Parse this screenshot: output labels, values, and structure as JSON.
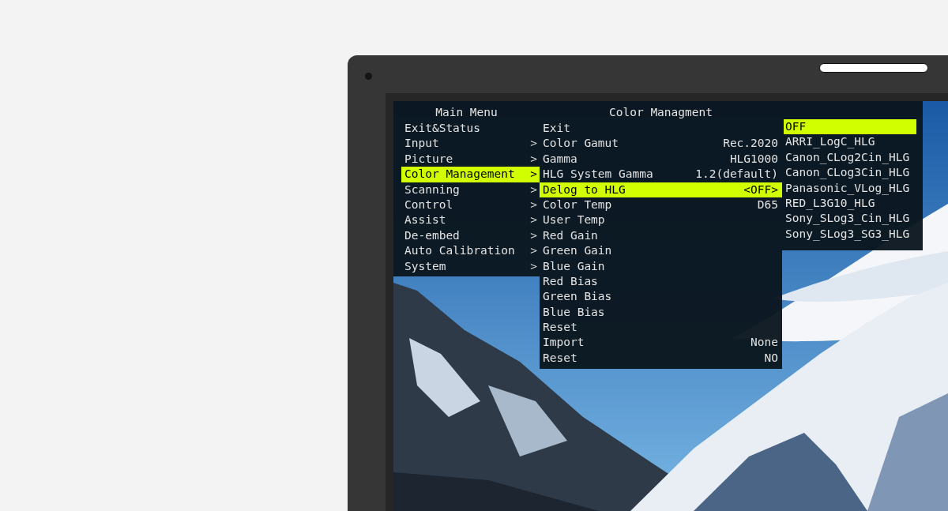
{
  "main_menu": {
    "title": "Main Menu",
    "items": [
      {
        "label": "Exit&Status",
        "selected": false
      },
      {
        "label": "Input",
        "arrow": ">",
        "selected": false
      },
      {
        "label": "Picture",
        "arrow": ">",
        "selected": false
      },
      {
        "label": "Color Management",
        "arrow": ">",
        "selected": true
      },
      {
        "label": "Scanning",
        "arrow": ">",
        "selected": false
      },
      {
        "label": "Control",
        "arrow": ">",
        "selected": false
      },
      {
        "label": "Assist",
        "arrow": ">",
        "selected": false
      },
      {
        "label": "De-embed",
        "arrow": ">",
        "selected": false
      },
      {
        "label": "Auto Calibration",
        "arrow": ">",
        "selected": false
      },
      {
        "label": "System",
        "arrow": ">",
        "selected": false
      }
    ]
  },
  "submenu": {
    "title": "Color Managment",
    "items": [
      {
        "label": "Exit",
        "selected": false
      },
      {
        "label": "Color Gamut",
        "value": "Rec.2020",
        "selected": false
      },
      {
        "label": "Gamma",
        "value": "HLG1000",
        "selected": false
      },
      {
        "label": "HLG System Gamma",
        "value": "1.2(default)",
        "selected": false
      },
      {
        "label": "Delog to HLG",
        "value": "<OFF>",
        "selected": true
      },
      {
        "label": "Color Temp",
        "value": "D65",
        "selected": false
      },
      {
        "label": "User Temp",
        "selected": false
      },
      {
        "label": "Red Gain",
        "selected": false
      },
      {
        "label": "Green Gain",
        "selected": false
      },
      {
        "label": "Blue Gain",
        "selected": false
      },
      {
        "label": "Red Bias",
        "selected": false
      },
      {
        "label": "Green Bias",
        "selected": false
      },
      {
        "label": "Blue Bias",
        "selected": false
      },
      {
        "label": "Reset",
        "selected": false
      },
      {
        "label": "Import",
        "value": "None",
        "selected": false
      },
      {
        "label": "Reset",
        "value": "NO",
        "selected": false
      }
    ]
  },
  "options": {
    "items": [
      {
        "label": "OFF",
        "selected": true
      },
      {
        "label": "ARRI_LogC_HLG",
        "selected": false
      },
      {
        "label": "Canon_CLog2Cin_HLG",
        "selected": false
      },
      {
        "label": "Canon_CLog3Cin_HLG",
        "selected": false
      },
      {
        "label": "Panasonic_VLog_HLG",
        "selected": false
      },
      {
        "label": "RED_L3G10_HLG",
        "selected": false
      },
      {
        "label": "Sony_SLog3_Cin_HLG",
        "selected": false
      },
      {
        "label": "Sony_SLog3_SG3_HLG",
        "selected": false
      }
    ]
  }
}
